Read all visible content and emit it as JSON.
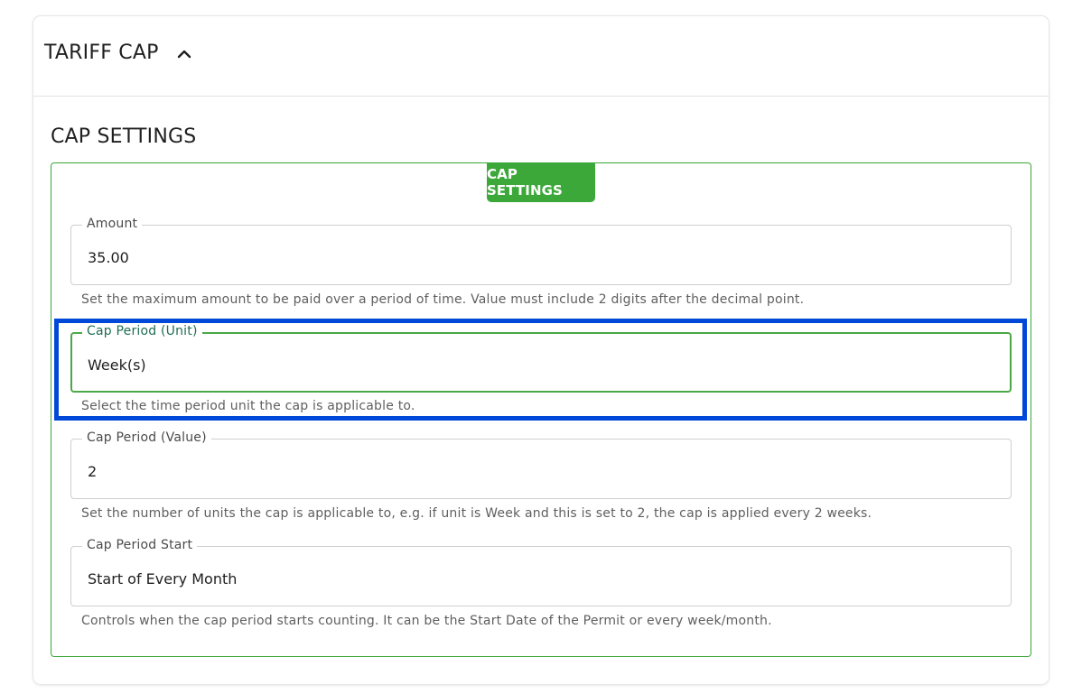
{
  "card": {
    "title": "TARIFF CAP",
    "toggle_icon": "chevron-up-icon"
  },
  "section": {
    "title": "CAP SETTINGS",
    "badge": "CAP SETTINGS"
  },
  "fields": {
    "amount": {
      "label": "Amount",
      "value": "35.00",
      "helper": "Set the maximum amount to be paid over a period of time. Value must include 2 digits after the decimal point."
    },
    "cap_period_unit": {
      "label": "Cap Period (Unit)",
      "value": "Week(s)",
      "helper": "Select the time period unit the cap is applicable to."
    },
    "cap_period_value": {
      "label": "Cap Period (Value)",
      "value": "2",
      "helper": "Set the number of units the cap is applicable to, e.g. if unit is Week and this is set to 2, the cap is applied every 2 weeks."
    },
    "cap_period_start": {
      "label": "Cap Period Start",
      "value": "Start of Every Month",
      "helper": "Controls when the cap period starts counting. It can be the Start Date of the Permit or every week/month."
    }
  },
  "colors": {
    "accent_green": "#3ca83a",
    "focus_green": "#4aa846",
    "highlight_blue": "#0048d8"
  }
}
